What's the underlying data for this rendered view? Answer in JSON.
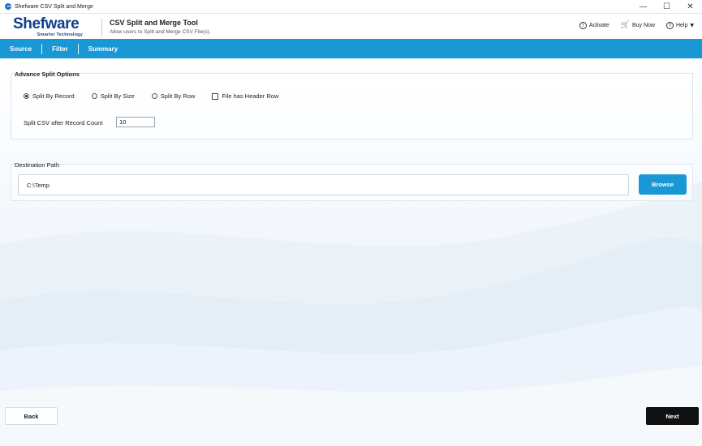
{
  "window": {
    "title": "Shefware CSV Split and Merge",
    "controls": {
      "minimize": "—",
      "maximize": "☐",
      "close": "✕"
    }
  },
  "header": {
    "logo_name": "Shefware",
    "logo_tagline": "Smarter Technology",
    "product_title": "CSV Split and Merge Tool",
    "product_subtitle": "Allow users to Split and Merge CSV File(s).",
    "actions": {
      "activate": {
        "label": "Activate",
        "icon": "info-circle-icon",
        "glyph": "!"
      },
      "buy_now": {
        "label": "Buy Now",
        "icon": "cart-icon",
        "glyph": "🛒"
      },
      "help": {
        "label": "Help",
        "icon": "question-circle-icon",
        "glyph": "?",
        "caret": "▼"
      }
    }
  },
  "nav": {
    "tabs": [
      {
        "label": "Source"
      },
      {
        "label": "Filter"
      },
      {
        "label": "Summary"
      }
    ]
  },
  "split_options": {
    "title": "Advance Split Options",
    "options": [
      {
        "label": "Split By Record",
        "checked": true
      },
      {
        "label": "Split By Size",
        "checked": false
      },
      {
        "label": "Split By Row",
        "checked": false
      }
    ],
    "header_row_checkbox": {
      "label": "File has Header Row",
      "checked": false
    },
    "record_count_label": "Split CSV after Record Count",
    "record_count_value": "10"
  },
  "destination": {
    "title": "Destination Path",
    "path": "C:\\Temp",
    "browse_label": "Browse"
  },
  "footer": {
    "back_label": "Back",
    "next_label": "Next"
  },
  "colors": {
    "accent": "#1a98d5",
    "brand": "#0f3f8c",
    "next_button": "#111111"
  }
}
